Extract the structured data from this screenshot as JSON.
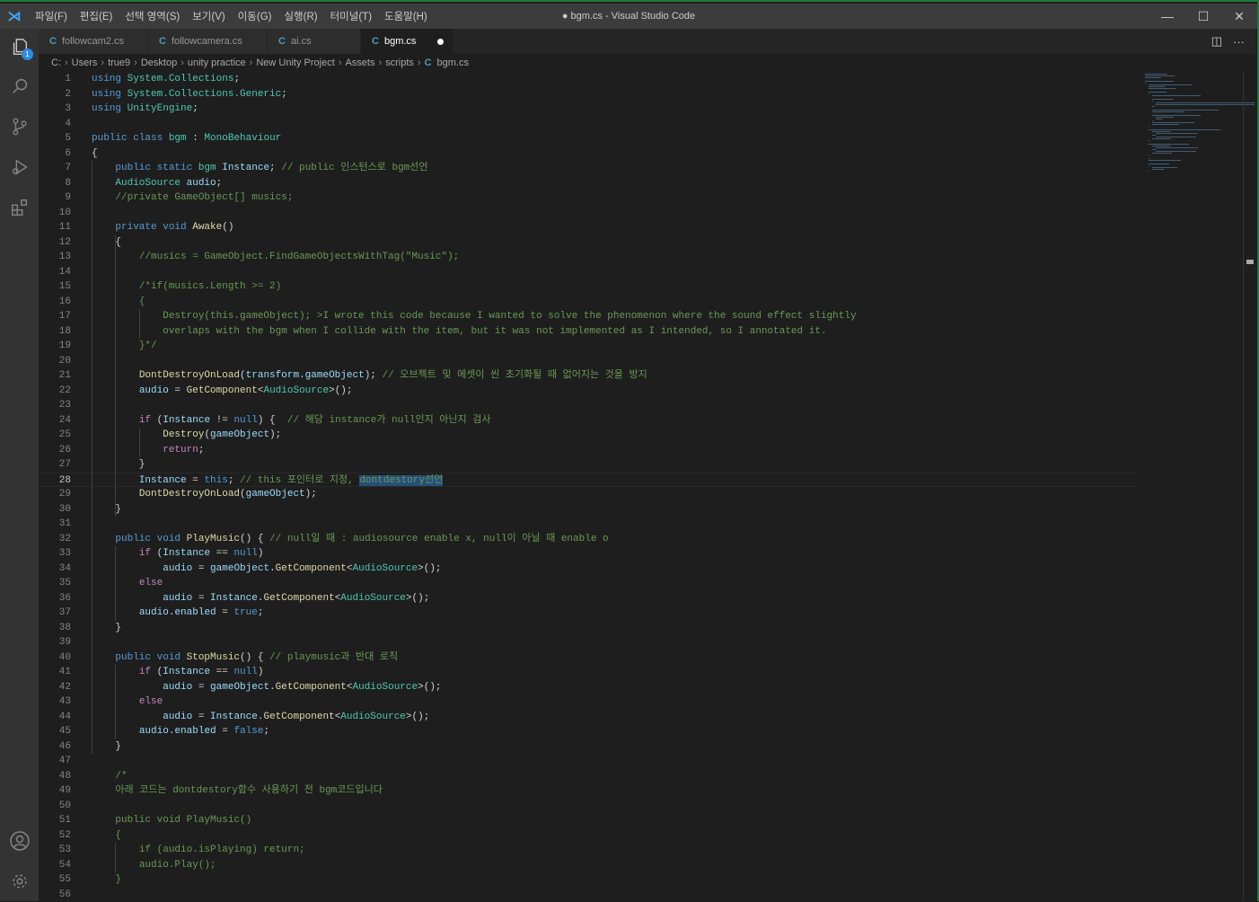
{
  "titlebar": {
    "menus": [
      "파일(F)",
      "편집(E)",
      "선택 영역(S)",
      "보기(V)",
      "이동(G)",
      "실행(R)",
      "터미널(T)",
      "도움말(H)"
    ],
    "title": "● bgm.cs - Visual Studio Code"
  },
  "activity": {
    "explorer_badge": "1"
  },
  "tabs": [
    {
      "label": "followcam2.cs",
      "active": false
    },
    {
      "label": "followcamera.cs",
      "active": false
    },
    {
      "label": "ai.cs",
      "active": false
    },
    {
      "label": "bgm.cs",
      "active": true,
      "dirty": true
    }
  ],
  "breadcrumb": [
    "C:",
    "Users",
    "true9",
    "Desktop",
    "unity practice",
    "New Unity Project",
    "Assets",
    "scripts",
    "bgm.cs"
  ],
  "editor": {
    "current_line": 28,
    "lines": [
      [
        [
          "k",
          "using "
        ],
        [
          "t",
          "System.Collections"
        ],
        [
          "p",
          ";"
        ]
      ],
      [
        [
          "k",
          "using "
        ],
        [
          "t",
          "System.Collections.Generic"
        ],
        [
          "p",
          ";"
        ]
      ],
      [
        [
          "k",
          "using "
        ],
        [
          "t",
          "UnityEngine"
        ],
        [
          "p",
          ";"
        ]
      ],
      [],
      [
        [
          "k",
          "public class "
        ],
        [
          "t",
          "bgm"
        ],
        [
          "p",
          " : "
        ],
        [
          "t",
          "MonoBehaviour"
        ]
      ],
      [
        [
          "p",
          "{"
        ]
      ],
      [
        [
          "p",
          "    "
        ],
        [
          "k",
          "public static "
        ],
        [
          "t",
          "bgm "
        ],
        [
          "v",
          "Instance"
        ],
        [
          "p",
          "; "
        ],
        [
          "c",
          "// public 인스턴스로 bgm선언"
        ]
      ],
      [
        [
          "p",
          "    "
        ],
        [
          "t",
          "AudioSource "
        ],
        [
          "v",
          "audio"
        ],
        [
          "p",
          ";"
        ]
      ],
      [
        [
          "p",
          "    "
        ],
        [
          "c",
          "//private GameObject[] musics;"
        ]
      ],
      [],
      [
        [
          "p",
          "    "
        ],
        [
          "k",
          "private void "
        ],
        [
          "f",
          "Awake"
        ],
        [
          "p",
          "()"
        ]
      ],
      [
        [
          "p",
          "    {"
        ]
      ],
      [
        [
          "p",
          "        "
        ],
        [
          "c",
          "//musics = GameObject.FindGameObjectsWithTag(\"Music\");"
        ]
      ],
      [],
      [
        [
          "p",
          "        "
        ],
        [
          "c",
          "/*if(musics.Length >= 2)"
        ]
      ],
      [
        [
          "p",
          "        "
        ],
        [
          "c",
          "{"
        ]
      ],
      [
        [
          "p",
          "            "
        ],
        [
          "c",
          "Destroy(this.gameObject); >I wrote this code because I wanted to solve the phenomenon where the sound effect slightly"
        ]
      ],
      [
        [
          "p",
          "            "
        ],
        [
          "c",
          "overlaps with the bgm when I collide with the item, but it was not implemented as I intended, so I annotated it."
        ]
      ],
      [
        [
          "p",
          "        "
        ],
        [
          "c",
          "}*/"
        ]
      ],
      [],
      [
        [
          "p",
          "        "
        ],
        [
          "f",
          "DontDestroyOnLoad"
        ],
        [
          "p",
          "("
        ],
        [
          "v",
          "transform"
        ],
        [
          "p",
          "."
        ],
        [
          "v",
          "gameObject"
        ],
        [
          "p",
          "); "
        ],
        [
          "c",
          "// 오브젝트 및 에셋이 씬 초기화될 때 없어지는 것을 방지"
        ]
      ],
      [
        [
          "p",
          "        "
        ],
        [
          "v",
          "audio"
        ],
        [
          "p",
          " = "
        ],
        [
          "f",
          "GetComponent"
        ],
        [
          "p",
          "<"
        ],
        [
          "t",
          "AudioSource"
        ],
        [
          "p",
          ">();"
        ]
      ],
      [],
      [
        [
          "p",
          "        "
        ],
        [
          "x",
          "if "
        ],
        [
          "p",
          "("
        ],
        [
          "v",
          "Instance"
        ],
        [
          "p",
          " != "
        ],
        [
          "k",
          "null"
        ],
        [
          "p",
          ") {  "
        ],
        [
          "c",
          "// 해당 instance가 null인지 아닌지 검사"
        ]
      ],
      [
        [
          "p",
          "            "
        ],
        [
          "f",
          "Destroy"
        ],
        [
          "p",
          "("
        ],
        [
          "v",
          "gameObject"
        ],
        [
          "p",
          ");"
        ]
      ],
      [
        [
          "p",
          "            "
        ],
        [
          "x",
          "return"
        ],
        [
          "p",
          ";"
        ]
      ],
      [
        [
          "p",
          "        }"
        ]
      ],
      [
        [
          "p",
          "        "
        ],
        [
          "v",
          "Instance"
        ],
        [
          "p",
          " = "
        ],
        [
          "k",
          "this"
        ],
        [
          "p",
          "; "
        ],
        [
          "c",
          "// this 포인터로 지정, "
        ],
        [
          "sel",
          "dontdestory선언"
        ]
      ],
      [
        [
          "p",
          "        "
        ],
        [
          "f",
          "DontDestroyOnLoad"
        ],
        [
          "p",
          "("
        ],
        [
          "v",
          "gameObject"
        ],
        [
          "p",
          ");"
        ]
      ],
      [
        [
          "p",
          "    }"
        ]
      ],
      [],
      [
        [
          "p",
          "    "
        ],
        [
          "k",
          "public void "
        ],
        [
          "f",
          "PlayMusic"
        ],
        [
          "p",
          "() { "
        ],
        [
          "c",
          "// null일 때 : audiosource enable x, null이 아닐 때 enable o"
        ]
      ],
      [
        [
          "p",
          "        "
        ],
        [
          "x",
          "if "
        ],
        [
          "p",
          "("
        ],
        [
          "v",
          "Instance"
        ],
        [
          "p",
          " == "
        ],
        [
          "k",
          "null"
        ],
        [
          "p",
          ")"
        ]
      ],
      [
        [
          "p",
          "            "
        ],
        [
          "v",
          "audio"
        ],
        [
          "p",
          " = "
        ],
        [
          "v",
          "gameObject"
        ],
        [
          "p",
          "."
        ],
        [
          "f",
          "GetComponent"
        ],
        [
          "p",
          "<"
        ],
        [
          "t",
          "AudioSource"
        ],
        [
          "p",
          ">();"
        ]
      ],
      [
        [
          "p",
          "        "
        ],
        [
          "x",
          "else"
        ]
      ],
      [
        [
          "p",
          "            "
        ],
        [
          "v",
          "audio"
        ],
        [
          "p",
          " = "
        ],
        [
          "v",
          "Instance"
        ],
        [
          "p",
          "."
        ],
        [
          "f",
          "GetComponent"
        ],
        [
          "p",
          "<"
        ],
        [
          "t",
          "AudioSource"
        ],
        [
          "p",
          ">();"
        ]
      ],
      [
        [
          "p",
          "        "
        ],
        [
          "v",
          "audio"
        ],
        [
          "p",
          "."
        ],
        [
          "v",
          "enabled"
        ],
        [
          "p",
          " = "
        ],
        [
          "k",
          "true"
        ],
        [
          "p",
          ";"
        ]
      ],
      [
        [
          "p",
          "    }"
        ]
      ],
      [],
      [
        [
          "p",
          "    "
        ],
        [
          "k",
          "public void "
        ],
        [
          "f",
          "StopMusic"
        ],
        [
          "p",
          "() { "
        ],
        [
          "c",
          "// playmusic과 반대 로직"
        ]
      ],
      [
        [
          "p",
          "        "
        ],
        [
          "x",
          "if "
        ],
        [
          "p",
          "("
        ],
        [
          "v",
          "Instance"
        ],
        [
          "p",
          " == "
        ],
        [
          "k",
          "null"
        ],
        [
          "p",
          ")"
        ]
      ],
      [
        [
          "p",
          "            "
        ],
        [
          "v",
          "audio"
        ],
        [
          "p",
          " = "
        ],
        [
          "v",
          "gameObject"
        ],
        [
          "p",
          "."
        ],
        [
          "f",
          "GetComponent"
        ],
        [
          "p",
          "<"
        ],
        [
          "t",
          "AudioSource"
        ],
        [
          "p",
          ">();"
        ]
      ],
      [
        [
          "p",
          "        "
        ],
        [
          "x",
          "else"
        ]
      ],
      [
        [
          "p",
          "            "
        ],
        [
          "v",
          "audio"
        ],
        [
          "p",
          " = "
        ],
        [
          "v",
          "Instance"
        ],
        [
          "p",
          "."
        ],
        [
          "f",
          "GetComponent"
        ],
        [
          "p",
          "<"
        ],
        [
          "t",
          "AudioSource"
        ],
        [
          "p",
          ">();"
        ]
      ],
      [
        [
          "p",
          "        "
        ],
        [
          "v",
          "audio"
        ],
        [
          "p",
          "."
        ],
        [
          "v",
          "enabled"
        ],
        [
          "p",
          " = "
        ],
        [
          "k",
          "false"
        ],
        [
          "p",
          ";"
        ]
      ],
      [
        [
          "p",
          "    }"
        ]
      ],
      [],
      [
        [
          "p",
          "    "
        ],
        [
          "c",
          "/*"
        ]
      ],
      [
        [
          "p",
          "    "
        ],
        [
          "c",
          "아래 코드는 dontdestory함수 사용하기 전 bgm코드입니다"
        ]
      ],
      [],
      [
        [
          "p",
          "    "
        ],
        [
          "c",
          "public void PlayMusic()"
        ]
      ],
      [
        [
          "p",
          "    "
        ],
        [
          "c",
          "{"
        ]
      ],
      [
        [
          "p",
          "        "
        ],
        [
          "c",
          "if (audio.isPlaying) return;"
        ]
      ],
      [
        [
          "p",
          "        "
        ],
        [
          "c",
          "audio.Play();"
        ]
      ],
      [
        [
          "p",
          "    "
        ],
        [
          "c",
          "}"
        ]
      ],
      []
    ]
  }
}
